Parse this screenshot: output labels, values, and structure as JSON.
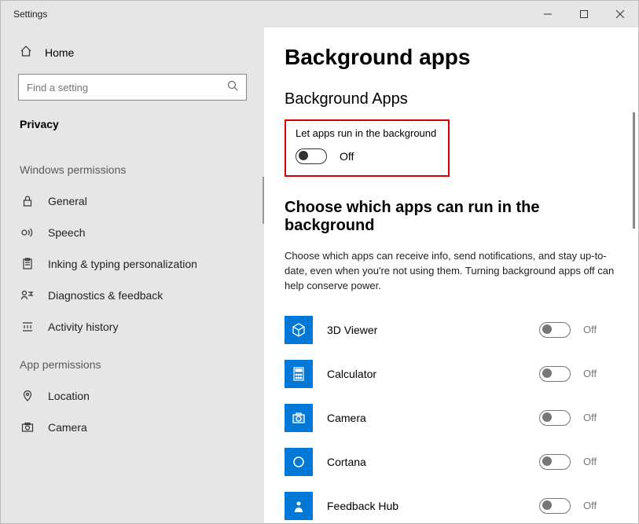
{
  "window": {
    "title": "Settings"
  },
  "sidebar": {
    "home_label": "Home",
    "search_placeholder": "Find a setting",
    "category": "Privacy",
    "section1": "Windows permissions",
    "section2": "App permissions",
    "items1": [
      {
        "icon": "lock",
        "label": "General"
      },
      {
        "icon": "speech",
        "label": "Speech"
      },
      {
        "icon": "inking",
        "label": "Inking & typing personalization"
      },
      {
        "icon": "feedback",
        "label": "Diagnostics & feedback"
      },
      {
        "icon": "activity",
        "label": "Activity history"
      }
    ],
    "items2": [
      {
        "icon": "location",
        "label": "Location"
      },
      {
        "icon": "camera",
        "label": "Camera"
      }
    ]
  },
  "content": {
    "title": "Background apps",
    "subtitle": "Background Apps",
    "master_label": "Let apps run in the background",
    "master_state": "Off",
    "choose_heading": "Choose which apps can run in the background",
    "choose_desc": "Choose which apps can receive info, send notifications, and stay up-to-date, even when you're not using them. Turning background apps off can help conserve power.",
    "apps": [
      {
        "name": "3D Viewer",
        "state": "Off",
        "icon": "cube"
      },
      {
        "name": "Calculator",
        "state": "Off",
        "icon": "calculator"
      },
      {
        "name": "Camera",
        "state": "Off",
        "icon": "camera"
      },
      {
        "name": "Cortana",
        "state": "Off",
        "icon": "cortana"
      },
      {
        "name": "Feedback Hub",
        "state": "Off",
        "icon": "feedbackhub"
      }
    ]
  }
}
